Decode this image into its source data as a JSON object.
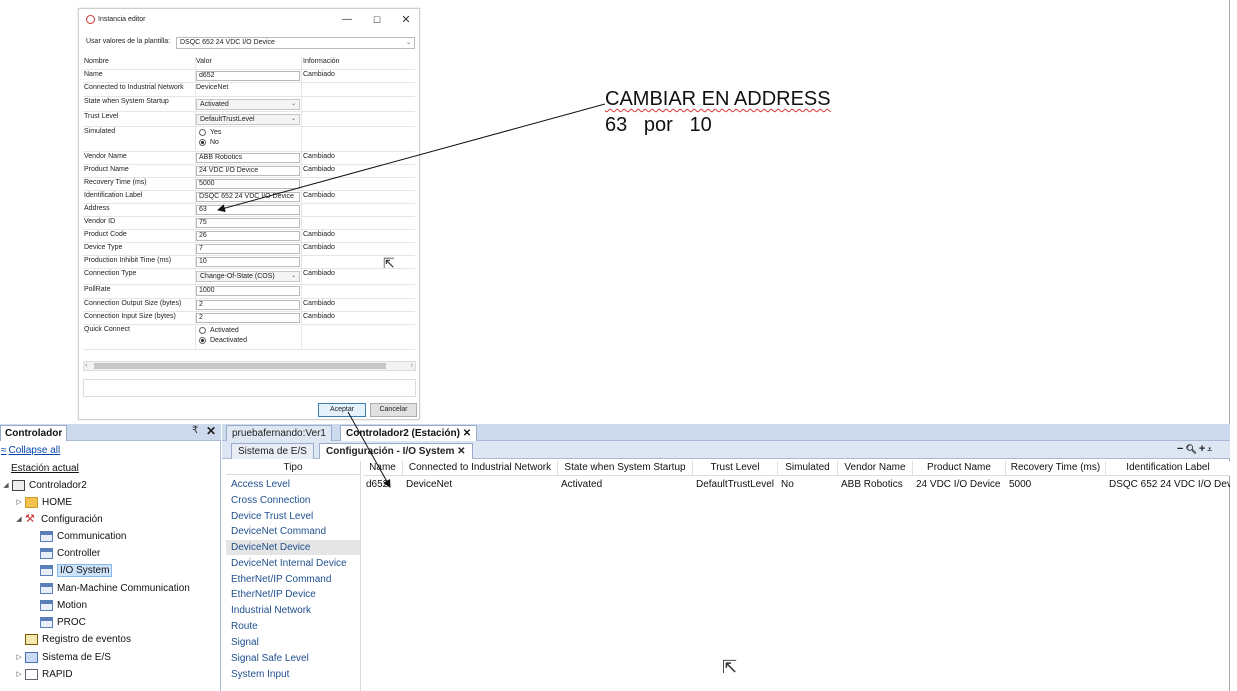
{
  "dialog": {
    "title": "Instancia editor",
    "template_label": "Usar valores de la plantilla:",
    "template_value": "DSQC 652 24 VDC I/O Device",
    "columns": {
      "name": "Nombre",
      "value": "Valor",
      "info": "Información"
    },
    "rows": {
      "name": {
        "label": "Name",
        "value": "d652",
        "info": "Cambiado"
      },
      "network": {
        "label": "Connected to Industrial Network",
        "value": "DeviceNet",
        "info": ""
      },
      "startup": {
        "label": "State when System Startup",
        "value": "Activated",
        "info": ""
      },
      "trust": {
        "label": "Trust Level",
        "value": "DefaultTrustLevel",
        "info": ""
      },
      "simulated": {
        "label": "Simulated",
        "opt_yes": "Yes",
        "opt_no": "No",
        "info": ""
      },
      "vendor_name": {
        "label": "Vendor Name",
        "value": "ABB Robotics",
        "info": "Cambiado"
      },
      "product_name": {
        "label": "Product Name",
        "value": "24 VDC I/O Device",
        "info": "Cambiado"
      },
      "recovery": {
        "label": "Recovery Time (ms)",
        "value": "5000",
        "info": ""
      },
      "ident": {
        "label": "Identification Label",
        "value": "DSQC 652 24 VDC I/O Device",
        "info": "Cambiado"
      },
      "address": {
        "label": "Address",
        "value": "63",
        "info": ""
      },
      "vendor_id": {
        "label": "Vendor ID",
        "value": "75",
        "info": ""
      },
      "product_code": {
        "label": "Product Code",
        "value": "26",
        "info": "Cambiado"
      },
      "device_type": {
        "label": "Device Type",
        "value": "7",
        "info": "Cambiado"
      },
      "inhibit": {
        "label": "Production Inhibit Time (ms)",
        "value": "10",
        "info": ""
      },
      "conn_type": {
        "label": "Connection Type",
        "value": "Change-Of-State (COS)",
        "info": "Cambiado"
      },
      "pollrate": {
        "label": "PollRate",
        "value": "1000",
        "info": ""
      },
      "out_size": {
        "label": "Connection Output Size (bytes)",
        "value": "2",
        "info": "Cambiado"
      },
      "in_size": {
        "label": "Connection Input Size (bytes)",
        "value": "2",
        "info": "Cambiado"
      },
      "quick": {
        "label": "Quick Connect",
        "opt_act": "Activated",
        "opt_deact": "Deactivated",
        "info": ""
      }
    },
    "ok_label": "Aceptar",
    "cancel_label": "Cancelar"
  },
  "note": {
    "line1": "CAMBIAR EN ADDRESS",
    "line2": "63   por   10"
  },
  "controller": {
    "tab": "Controlador",
    "collapse": "Collapse all",
    "current_station": "Estación actual",
    "tree": {
      "controller": "Controlador2",
      "home": "HOME",
      "config": "Configuración",
      "communication": "Communication",
      "controller_cfg": "Controller",
      "io": "I/O System",
      "mmc": "Man-Machine Communication",
      "motion": "Motion",
      "proc": "PROC",
      "events": "Registro de eventos",
      "io_sys": "Sistema de E/S",
      "rapid": "RAPID"
    }
  },
  "main": {
    "doc_tab1": "pruebafernando:Ver1",
    "doc_tab2": "Controlador2 (Estación)",
    "sub_tab1": "Sistema de E/S",
    "sub_tab2": "Configuración - I/O System",
    "type_header": "Tipo",
    "types": [
      "Access Level",
      "Cross Connection",
      "Device Trust Level",
      "DeviceNet Command",
      "DeviceNet Device",
      "DeviceNet Internal Device",
      "EtherNet/IP Command",
      "EtherNet/IP Device",
      "Industrial Network",
      "Route",
      "Signal",
      "Signal Safe Level",
      "System Input"
    ],
    "table": {
      "headers": [
        "Name",
        "Connected to Industrial Network",
        "State when System Startup",
        "Trust Level",
        "Simulated",
        "Vendor Name",
        "Product Name",
        "Recovery Time (ms)",
        "Identification Label"
      ],
      "row": [
        "d652",
        "DeviceNet",
        "Activated",
        "DefaultTrustLevel",
        "No",
        "ABB Robotics",
        "24 VDC I/O Device",
        "5000",
        "DSQC 652 24 VDC I/O Dev"
      ]
    }
  }
}
